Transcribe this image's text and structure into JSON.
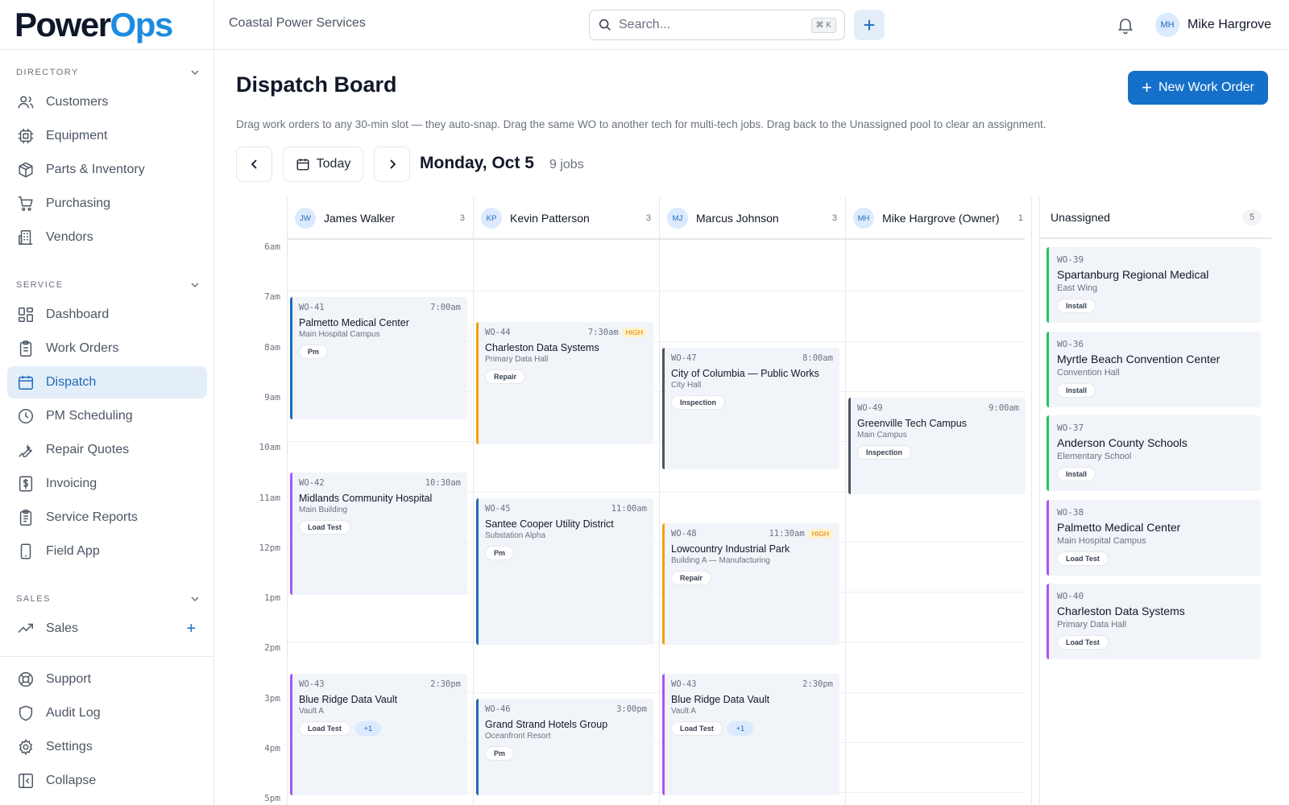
{
  "brand": {
    "part1": "Power",
    "part2": "Ops"
  },
  "colors": {
    "accent": "#1570c9",
    "pm": "#1e6bb8",
    "repair": "#f59e0b",
    "inspection": "#4b5563",
    "load_test": "#a855f7",
    "install": "#22c55e"
  },
  "header": {
    "company": "Coastal Power Services",
    "search_placeholder": "Search...",
    "search_shortcut": "⌘ K",
    "add_icon": "plus-icon",
    "notification_icon": "bell-icon",
    "user": {
      "initials": "MH",
      "name": "Mike Hargrove"
    }
  },
  "sidebar": {
    "sections": {
      "directory": "DIRECTORY",
      "service": "SERVICE",
      "sales": "SALES"
    },
    "directory_items": [
      {
        "label": "Customers",
        "icon": "users-icon"
      },
      {
        "label": "Equipment",
        "icon": "chip-icon"
      },
      {
        "label": "Parts & Inventory",
        "icon": "box-icon"
      },
      {
        "label": "Purchasing",
        "icon": "cart-icon"
      },
      {
        "label": "Vendors",
        "icon": "building-icon"
      }
    ],
    "service_items": [
      {
        "label": "Dashboard",
        "icon": "grid-icon"
      },
      {
        "label": "Work Orders",
        "icon": "clipboard-icon"
      },
      {
        "label": "Dispatch",
        "icon": "calendar-icon",
        "active": true
      },
      {
        "label": "PM Scheduling",
        "icon": "clock-icon"
      },
      {
        "label": "Repair Quotes",
        "icon": "wrench-icon"
      },
      {
        "label": "Invoicing",
        "icon": "dollar-icon"
      },
      {
        "label": "Service Reports",
        "icon": "report-icon"
      },
      {
        "label": "Field App",
        "icon": "phone-icon"
      }
    ],
    "sales_items": [
      {
        "label": "Sales",
        "icon": "trend-icon"
      }
    ],
    "bottom_items": [
      {
        "label": "Support",
        "icon": "lifebuoy-icon"
      },
      {
        "label": "Audit Log",
        "icon": "shield-icon"
      },
      {
        "label": "Settings",
        "icon": "gear-icon"
      },
      {
        "label": "Collapse",
        "icon": "collapse-icon"
      }
    ]
  },
  "main": {
    "title": "Dispatch Board",
    "new_button": "New Work Order",
    "hint": "Drag work orders to any 30-min slot — they auto-snap. Drag the same WO to another tech for multi-tech jobs. Drag back to the Unassigned pool to clear an assignment.",
    "today": "Today",
    "date": "Monday, Oct 5",
    "jobs": "9 jobs"
  },
  "hours": [
    "6am",
    "7am",
    "8am",
    "9am",
    "10am",
    "11am",
    "12pm",
    "1pm",
    "2pm",
    "3pm",
    "4pm",
    "5pm"
  ],
  "techs": [
    {
      "initials": "JW",
      "name": "James Walker",
      "count": "3"
    },
    {
      "initials": "KP",
      "name": "Kevin Patterson",
      "count": "3"
    },
    {
      "initials": "MJ",
      "name": "Marcus Johnson",
      "count": "3"
    },
    {
      "initials": "MH",
      "name": "Mike Hargrove (Owner)",
      "count": "1"
    }
  ],
  "cards": [
    {
      "tech": 0,
      "start": 7.0,
      "end": 9.5,
      "wo": "WO-41",
      "time": "7:00am",
      "title": "Palmetto Medical Center",
      "sub": "Main Hospital Campus",
      "tag": "Pm",
      "color": "#1e6bb8"
    },
    {
      "tech": 0,
      "start": 10.5,
      "end": 13.0,
      "wo": "WO-42",
      "time": "10:30am",
      "title": "Midlands Community Hospital",
      "sub": "Main Building",
      "tag": "Load Test",
      "color": "#a855f7"
    },
    {
      "tech": 0,
      "start": 14.5,
      "end": 17.0,
      "wo": "WO-43",
      "time": "2:30pm",
      "title": "Blue Ridge Data Vault",
      "sub": "Vault A",
      "tag": "Load Test",
      "extra": "+1",
      "color": "#a855f7"
    },
    {
      "tech": 1,
      "start": 7.5,
      "end": 10.0,
      "wo": "WO-44",
      "time": "7:30am",
      "priority": "HIGH",
      "title": "Charleston Data Systems",
      "sub": "Primary Data Hall",
      "tag": "Repair",
      "color": "#f59e0b"
    },
    {
      "tech": 1,
      "start": 11.0,
      "end": 14.0,
      "wo": "WO-45",
      "time": "11:00am",
      "title": "Santee Cooper Utility District",
      "sub": "Substation Alpha",
      "tag": "Pm",
      "color": "#1e6bb8"
    },
    {
      "tech": 1,
      "start": 15.0,
      "end": 17.0,
      "wo": "WO-46",
      "time": "3:00pm",
      "title": "Grand Strand Hotels Group",
      "sub": "Oceanfront Resort",
      "tag": "Pm",
      "color": "#1e6bb8"
    },
    {
      "tech": 2,
      "start": 8.0,
      "end": 10.5,
      "wo": "WO-47",
      "time": "8:00am",
      "title": "City of Columbia — Public Works",
      "sub": "City Hall",
      "tag": "Inspection",
      "color": "#4b5563"
    },
    {
      "tech": 2,
      "start": 11.5,
      "end": 14.0,
      "wo": "WO-48",
      "time": "11:30am",
      "priority": "HIGH",
      "title": "Lowcountry Industrial Park",
      "sub": "Building A — Manufacturing",
      "tag": "Repair",
      "color": "#f59e0b"
    },
    {
      "tech": 2,
      "start": 14.5,
      "end": 17.0,
      "wo": "WO-43",
      "time": "2:30pm",
      "title": "Blue Ridge Data Vault",
      "sub": "Vault A",
      "tag": "Load Test",
      "extra": "+1",
      "color": "#a855f7"
    },
    {
      "tech": 3,
      "start": 9.0,
      "end": 11.0,
      "wo": "WO-49",
      "time": "9:00am",
      "title": "Greenville Tech Campus",
      "sub": "Main Campus",
      "tag": "Inspection",
      "color": "#4b5563"
    }
  ],
  "unassigned": {
    "label": "Unassigned",
    "count": "5",
    "items": [
      {
        "wo": "WO-39",
        "title": "Spartanburg Regional Medical",
        "sub": "East Wing",
        "tag": "Install",
        "color": "#22c55e"
      },
      {
        "wo": "WO-36",
        "title": "Myrtle Beach Convention Center",
        "sub": "Convention Hall",
        "tag": "Install",
        "color": "#22c55e"
      },
      {
        "wo": "WO-37",
        "title": "Anderson County Schools",
        "sub": "Elementary School",
        "tag": "Install",
        "color": "#22c55e"
      },
      {
        "wo": "WO-38",
        "title": "Palmetto Medical Center",
        "sub": "Main Hospital Campus",
        "tag": "Load Test",
        "color": "#a855f7"
      },
      {
        "wo": "WO-40",
        "title": "Charleston Data Systems",
        "sub": "Primary Data Hall",
        "tag": "Load Test",
        "color": "#a855f7"
      }
    ]
  }
}
